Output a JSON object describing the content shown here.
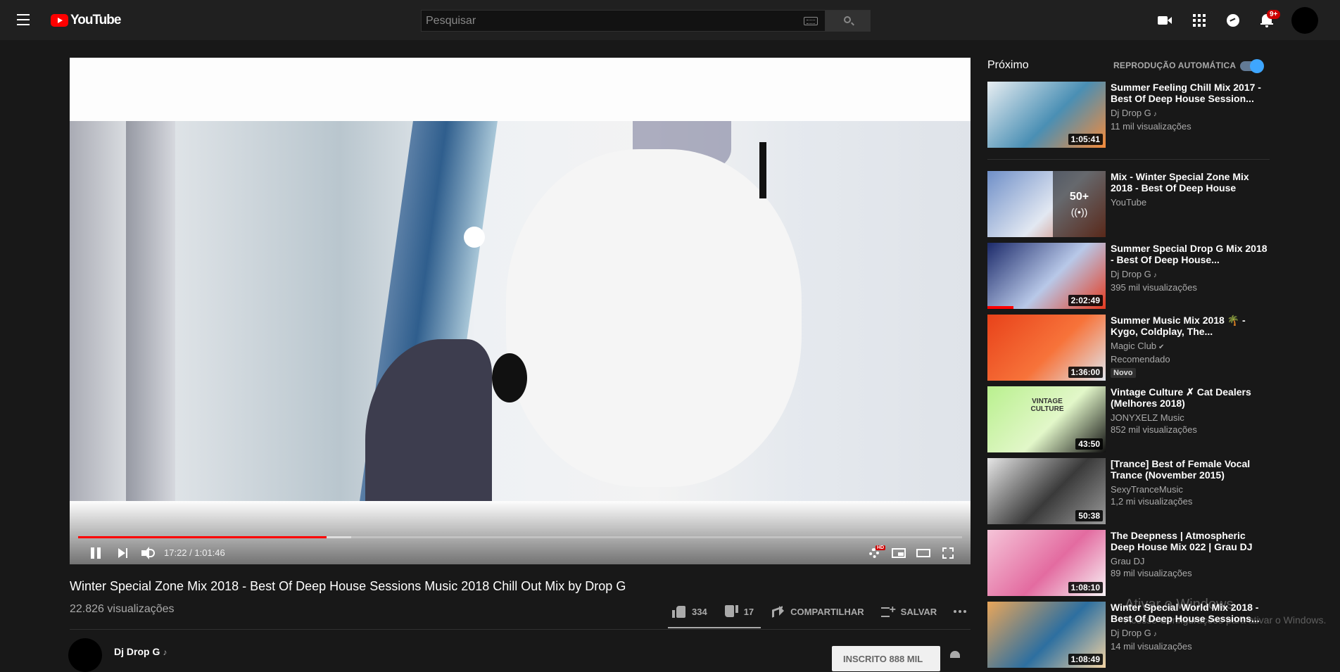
{
  "header": {
    "logo_text": "YouTube",
    "search_placeholder": "Pesquisar",
    "notification_count": "9+"
  },
  "player": {
    "time_current": "17:22",
    "time_total": "1:01:46",
    "time_display": "17:22 / 1:01:46",
    "played_fraction": 0.281,
    "loaded_fraction": 0.309,
    "hd_badge": "HD"
  },
  "video": {
    "title": "Winter Special Zone Mix 2018 - Best Of Deep House Sessions Music 2018 Chill Out Mix by Drop G",
    "views": "22.826 visualizações",
    "likes": "334",
    "dislikes": "17",
    "share_label": "COMPARTILHAR",
    "save_label": "SALVAR",
    "like_ratio": 0.95
  },
  "channel": {
    "name": "Dj Drop G",
    "note_icon": "♪",
    "subscribe_label": "INSCRITO  888 MIL"
  },
  "sidebar": {
    "up_next_label": "Próximo",
    "autoplay_label": "REPRODUÇÃO AUTOMÁTICA",
    "autoplay_on": true,
    "items": [
      {
        "title": "Summer Feeling Chill Mix 2017 - Best Of Deep House Session...",
        "channel": "Dj Drop G",
        "note": "♪",
        "stats": "11 mil visualizações",
        "duration": "1:05:41",
        "colors": [
          "#e8eef2",
          "#4a8fb4",
          "#f58b3a"
        ]
      },
      {
        "title": "Mix - Winter Special Zone Mix 2018 - Best Of Deep House Sessions...",
        "channel": "YouTube",
        "stats": "",
        "duration": "",
        "mix_count": "50+",
        "mix_icon": "((•))",
        "colors": [
          "#6f8fc8",
          "#e2e8f2",
          "#c75a3a"
        ]
      },
      {
        "title": "Summer Special Drop G Mix 2018 - Best Of Deep House...",
        "channel": "Dj Drop G",
        "note": "♪",
        "stats": "395 mil visualizações",
        "duration": "2:02:49",
        "watched_fraction": 0.22,
        "colors": [
          "#1c2a6a",
          "#b8c8e8",
          "#e53a1f"
        ]
      },
      {
        "title": "Summer Music Mix 2018 🌴 - Kygo, Coldplay, The...",
        "channel": "Magic Club",
        "verified": "✔",
        "stats": "Recomendado",
        "badge": "Novo",
        "duration": "1:36:00",
        "colors": [
          "#e8421a",
          "#f7733a",
          "#e0e6ee"
        ]
      },
      {
        "title": "Vintage Culture ✗ Cat Dealers (Melhores 2018)",
        "channel": "JONYXELZ Music",
        "stats": "852 mil visualizações",
        "duration": "43:50",
        "overlay_text": "VINTAGE CULTURE",
        "colors": [
          "#b9f08e",
          "#e2f7c9",
          "#111111"
        ]
      },
      {
        "title": "[Trance] Best of Female Vocal Trance (November 2015)",
        "channel": "SexyTranceMusic",
        "stats": "1,2 mi visualizações",
        "duration": "50:38",
        "colors": [
          "#e6e6e6",
          "#3a3a3a",
          "#9a9a9a"
        ]
      },
      {
        "title": "The Deepness | Atmospheric Deep House Mix 022 | Grau DJ",
        "channel": "Grau DJ",
        "stats": "89 mil visualizações",
        "duration": "1:08:10",
        "colors": [
          "#f5c4d8",
          "#e36ba0",
          "#f8f3f5"
        ]
      },
      {
        "title": "Winter Special World Mix 2018 - Best Of Deep House Sessions...",
        "channel": "Dj Drop G",
        "note": "♪",
        "stats": "14 mil visualizações",
        "duration": "1:08:49",
        "colors": [
          "#e9a65a",
          "#2d6fa0",
          "#f3d3a3"
        ]
      }
    ]
  },
  "watermark": {
    "line1": "Ativar o Windows",
    "line2": "Acesse Configurações para ativar o Windows."
  }
}
